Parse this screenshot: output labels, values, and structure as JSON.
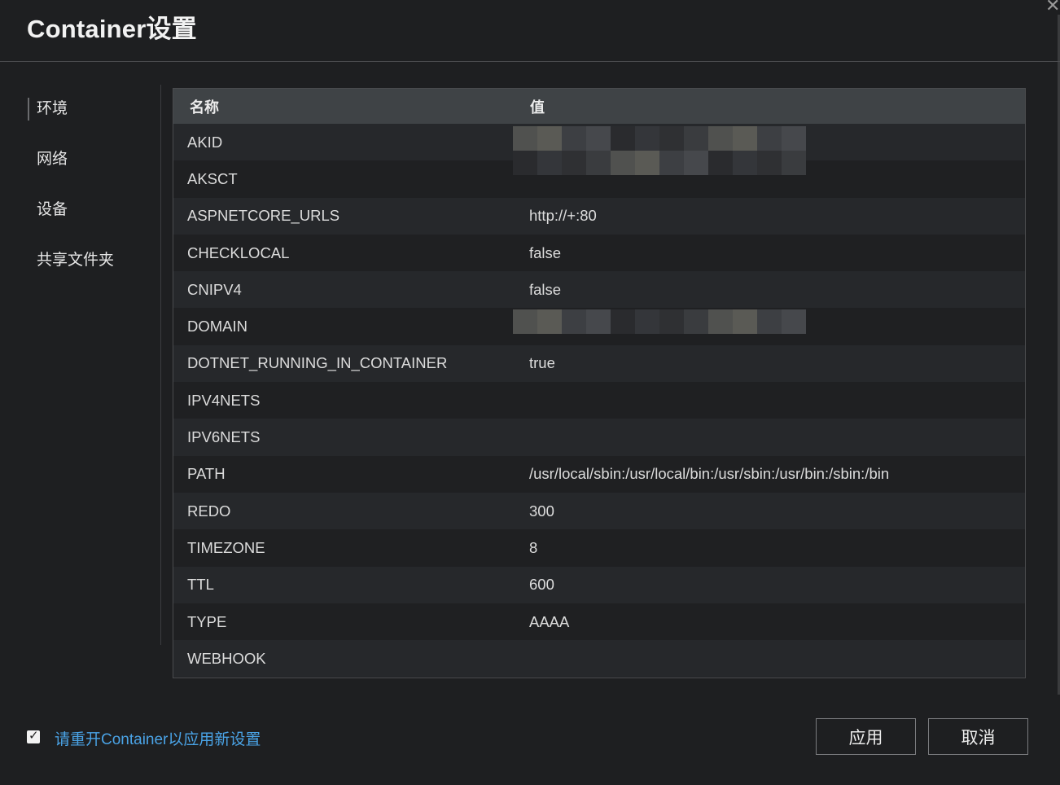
{
  "window": {
    "title": "Container设置",
    "close_glyph": "✕"
  },
  "sidebar": {
    "items": [
      {
        "label": "环境",
        "active": true
      },
      {
        "label": "网络"
      },
      {
        "label": "设备"
      },
      {
        "label": "共享文件夹"
      }
    ]
  },
  "table": {
    "headers": {
      "name": "名称",
      "value": "值"
    },
    "rows": [
      {
        "name": "AKID",
        "value": "",
        "redacted": true
      },
      {
        "name": "AKSCT",
        "value": "",
        "redacted": true
      },
      {
        "name": "ASPNETCORE_URLS",
        "value": "http://+:80"
      },
      {
        "name": "CHECKLOCAL",
        "value": "false"
      },
      {
        "name": "CNIPV4",
        "value": "false"
      },
      {
        "name": "DOMAIN",
        "value": "",
        "redacted": true
      },
      {
        "name": "DOTNET_RUNNING_IN_CONTAINER",
        "value": "true"
      },
      {
        "name": "IPV4NETS",
        "value": ""
      },
      {
        "name": "IPV6NETS",
        "value": ""
      },
      {
        "name": "PATH",
        "value": "/usr/local/sbin:/usr/local/bin:/usr/sbin:/usr/bin:/sbin:/bin"
      },
      {
        "name": "REDO",
        "value": "300"
      },
      {
        "name": "TIMEZONE",
        "value": "8"
      },
      {
        "name": "TTL",
        "value": "600"
      },
      {
        "name": "TYPE",
        "value": "AAAA"
      },
      {
        "name": "WEBHOOK",
        "value": ""
      }
    ]
  },
  "footer": {
    "restart_checkbox_checked": true,
    "restart_label": "请重开Container以应用新设置",
    "apply_label": "应用",
    "cancel_label": "取消"
  },
  "colors": {
    "background": "#1e1f21",
    "header_row": "#3f4346",
    "link_blue": "#4aa3e6"
  }
}
